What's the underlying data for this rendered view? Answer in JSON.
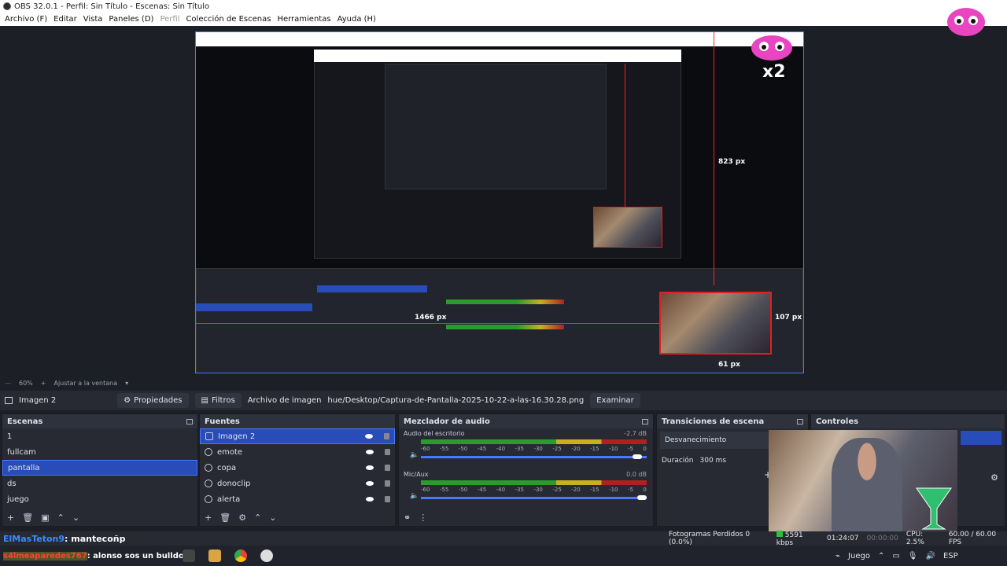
{
  "window": {
    "title": "OBS 32.0.1 - Perfil: Sin Título - Escenas: Sin Título"
  },
  "menu": [
    {
      "label": "Archivo (F)",
      "disabled": false
    },
    {
      "label": "Editar",
      "disabled": false
    },
    {
      "label": "Vista",
      "disabled": false
    },
    {
      "label": "Paneles (D)",
      "disabled": false
    },
    {
      "label": "Perfil",
      "disabled": true
    },
    {
      "label": "Colección de Escenas",
      "disabled": false
    },
    {
      "label": "Herramientas",
      "disabled": false
    },
    {
      "label": "Ayuda (H)",
      "disabled": false
    }
  ],
  "preview": {
    "measure_vertical": "823 px",
    "measure_horizontal": "1466 px",
    "measure_right": "107 px",
    "measure_bottom": "61 px",
    "mascot_text": "x2"
  },
  "zoom": {
    "percent": "60%",
    "fit_label": "Ajustar a la ventana"
  },
  "propbar": {
    "source_name": "Imagen 2",
    "properties_label": "Propiedades",
    "filters_label": "Filtros",
    "image_file_label": "Archivo de imagen",
    "image_path": "hue/Desktop/Captura-de-Pantalla-2025-10-22-a-las-16.30.28.png",
    "browse_label": "Examinar"
  },
  "scenes": {
    "title": "Escenas",
    "items": [
      "1",
      "fullcam",
      "pantalla",
      "ds",
      "juego"
    ],
    "selected": "pantalla"
  },
  "sources": {
    "title": "Fuentes",
    "items": [
      "Imagen 2",
      "emote",
      "copa",
      "donoclip",
      "alerta"
    ],
    "selected": "Imagen 2"
  },
  "mixer": {
    "title": "Mezclador de audio",
    "channels": [
      {
        "name": "Audio del escritorio",
        "db": "-2.7 dB",
        "volume": 0.98
      },
      {
        "name": "Mic/Aux",
        "db": "0.0 dB",
        "volume": 1.0
      }
    ],
    "scale": [
      "-60",
      "-55",
      "-50",
      "-45",
      "-40",
      "-35",
      "-30",
      "-25",
      "-20",
      "-15",
      "-10",
      "-5",
      "0"
    ]
  },
  "transitions": {
    "title": "Transiciones de escena",
    "selected": "Desvanecimiento",
    "duration_label": "Duración",
    "duration_value": "300 ms"
  },
  "controls": {
    "title": "Controles"
  },
  "status": {
    "chat_user": "ElMasTeton9",
    "chat_message": ": mantecoñp",
    "dropped_frames": "Fotogramas Perdidos 0 (0.0%)",
    "bitrate": "5591 kbps",
    "stream_time": "01:24:07",
    "rec_time": "00:00:00",
    "cpu": "CPU: 2.5%",
    "fps": "60.00 / 60.00 FPS"
  },
  "taskbar": {
    "chat_user": "s4lmeaparedes767",
    "chat_message": ": alonso sos un bulldog",
    "game_label": "Juego",
    "language": "ESP"
  },
  "colors": {
    "accent": "#284cb8",
    "selection_border": "#4a78ff",
    "measure_line": "#ff2020"
  }
}
